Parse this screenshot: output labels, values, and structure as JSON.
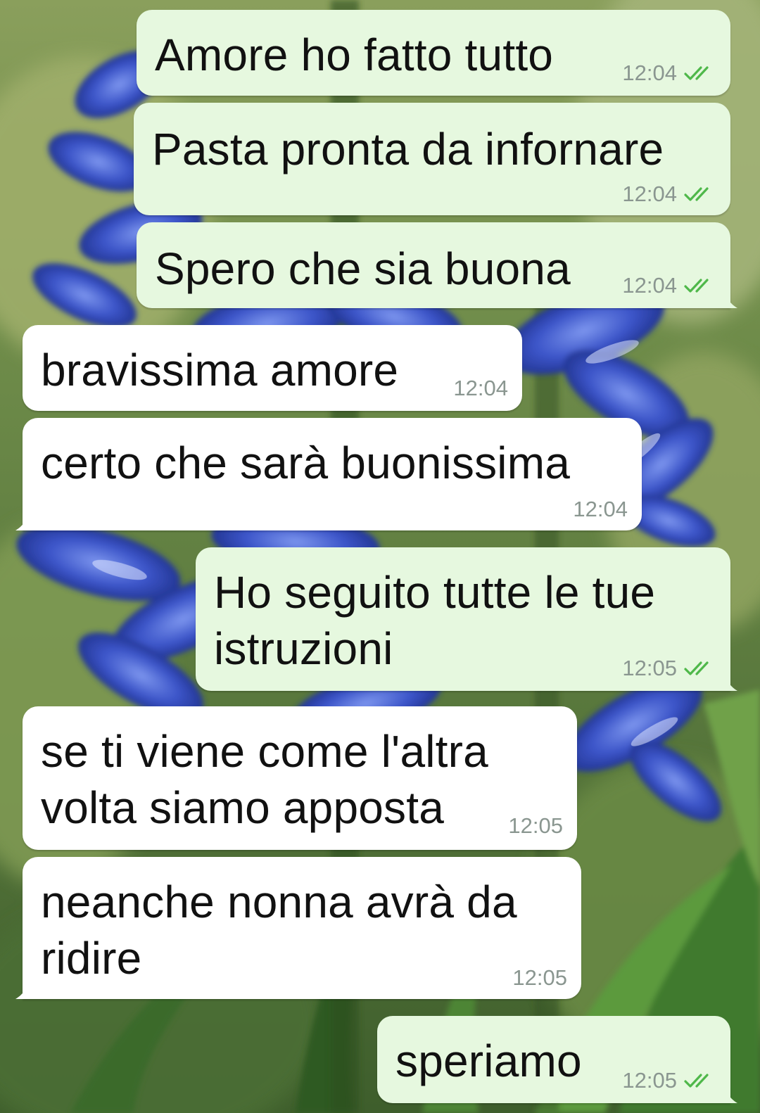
{
  "chat": {
    "messages": [
      {
        "direction": "outgoing",
        "lines": [
          "Amore ho fatto tutto"
        ],
        "time": "12:04",
        "status": "read"
      },
      {
        "direction": "outgoing",
        "lines": [
          "Pasta pronta da infornare"
        ],
        "time": "12:04",
        "status": "read"
      },
      {
        "direction": "outgoing",
        "lines": [
          "Spero che sia buona"
        ],
        "time": "12:04",
        "status": "read"
      },
      {
        "direction": "incoming",
        "lines": [
          "bravissima amore"
        ],
        "time": "12:04"
      },
      {
        "direction": "incoming",
        "lines": [
          "certo che sarà buonissima"
        ],
        "time": "12:04"
      },
      {
        "direction": "outgoing",
        "lines": [
          "Ho seguito tutte le tue",
          "istruzioni"
        ],
        "time": "12:05",
        "status": "read"
      },
      {
        "direction": "incoming",
        "lines": [
          "se ti viene come l'altra",
          "volta siamo apposta"
        ],
        "time": "12:05"
      },
      {
        "direction": "incoming",
        "lines": [
          "neanche nonna avrà da",
          "ridire"
        ],
        "time": "12:05"
      },
      {
        "direction": "outgoing",
        "lines": [
          "speriamo"
        ],
        "time": "12:05",
        "status": "read"
      }
    ]
  },
  "colors": {
    "outgoing_bubble": "#e6f8df",
    "incoming_bubble": "#ffffff",
    "read_ticks": "#4fb84a",
    "timestamp": "#8a9690"
  },
  "icons": {
    "read_status": "double-check-icon"
  },
  "wallpaper": {
    "subject": "blue hyacinth flowers with green leaves"
  }
}
